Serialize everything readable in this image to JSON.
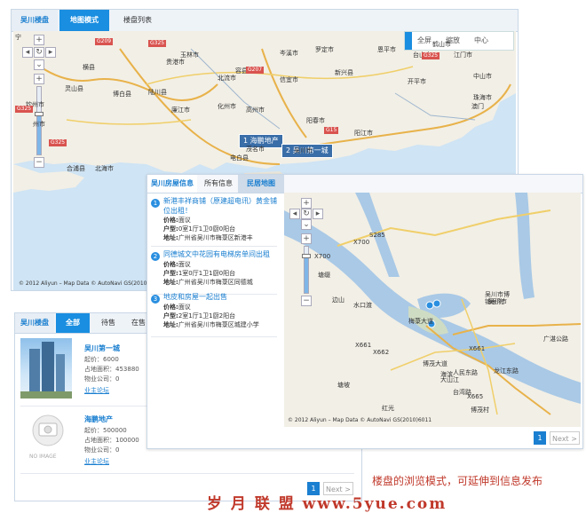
{
  "panel_top": {
    "brand": "吴川楼盘",
    "tabs": [
      {
        "label": "地图模式",
        "active": true
      },
      {
        "label": "楼盘列表",
        "active": false
      }
    ],
    "map_controls": [
      "全屏",
      "缩放",
      "中心"
    ],
    "markers": [
      {
        "num": "1",
        "label": "海鹏地产"
      },
      {
        "num": "2",
        "label": "吴川第一城"
      }
    ],
    "place_labels": [
      "宁",
      "玉林市",
      "横县",
      "贵港市",
      "灵山县",
      "钦州市",
      "北流市",
      "容县",
      "岑溪市",
      "博白县",
      "陆川县",
      "廉江市",
      "化州市",
      "高州市",
      "信宜市",
      "罗定市",
      "阳春市",
      "阳江市",
      "茂名市",
      "电白县",
      "吴川市",
      "北海市",
      "合浦县",
      "恩平市",
      "台山市",
      "江门市",
      "中山市",
      "珠海市",
      "澳门",
      "开平市",
      "鹤山市",
      "新兴县",
      "州市"
    ],
    "road_labels": [
      "G209",
      "G207",
      "G325",
      "G325",
      "G325",
      "G15",
      "G325"
    ],
    "credit": "© 2012 Aliyun – Map Data © AutoNavi GS(2010)6011"
  },
  "panel_middle": {
    "tabs": [
      {
        "label": "吴川房屋信息",
        "active": false
      },
      {
        "label": "所有信息",
        "active": false
      },
      {
        "label": "民居地图",
        "active": true
      }
    ],
    "items": [
      {
        "num": "1",
        "title": "新港丰祥商铺（原建超电讯）黄金铺位出租！",
        "price_label": "价格:",
        "price": "面议",
        "layout_label": "户型:",
        "layout": "0室1厅1卫0厨0阳台",
        "address_label": "地址:",
        "address": "广州省吴川市梅菉区新港丰"
      },
      {
        "num": "2",
        "title": "同德城文中花园有电梯房单间出租",
        "price_label": "价格:",
        "price": "面议",
        "layout_label": "户型:",
        "layout": "1室0厅1卫1厨0阳台",
        "address_label": "地址:",
        "address": "广州省吴川市梅菉区同德城"
      },
      {
        "num": "3",
        "title": "地皮和房屋一起出售",
        "price_label": "价格:",
        "price": "面议",
        "layout_label": "户型:",
        "layout": "2室1厅1卫1厨2阳台",
        "address_label": "地址:",
        "address": "广州省吴川市梅菉区城建小学"
      }
    ],
    "map_labels": [
      "X700",
      "S285",
      "X700",
      "吴川市博",
      "铺医院",
      "塘缀",
      "边山",
      "水口渡",
      "梅菉大道",
      "X661",
      "X662",
      "广湛公路",
      "X661",
      "博茂大道",
      "海滨",
      "吴川市",
      "大山江",
      "人民东路",
      "龙江东路",
      "台湾路",
      "塘坡",
      "X665",
      "博茂村",
      "红光"
    ],
    "credit": "© 2012 Aliyun – Map Data © AutoNavi GS(2010)6011",
    "pager": {
      "current": "1",
      "next": "Next >"
    }
  },
  "panel_bottom": {
    "brand": "吴川楼盘",
    "tabs": [
      {
        "label": "全部",
        "active": true
      },
      {
        "label": "待售",
        "active": false
      },
      {
        "label": "在售",
        "active": false
      }
    ],
    "houses": [
      {
        "name": "吴川第一城",
        "price": "起价：6000",
        "area": "占地面积：453880",
        "fee": "物业公司：0",
        "link": "业主论坛"
      },
      {
        "name": "海鹏地产",
        "price": "起价：500000",
        "area": "占地面积：100000",
        "fee": "物业公司：0",
        "link": "业主论坛",
        "noimage": "NO IMAGE"
      }
    ],
    "pager": {
      "current": "1",
      "next": "Next >"
    }
  },
  "caption": "楼盘的浏览模式，可延伸到信息发布",
  "watermark": "岁 月 联 盟   www.5yue.com",
  "colors": {
    "accent": "#1a8ee0",
    "link": "#1a7fd0",
    "caption": "#c0392b",
    "sea": "#cfe4f4",
    "land": "#f2efe6"
  }
}
